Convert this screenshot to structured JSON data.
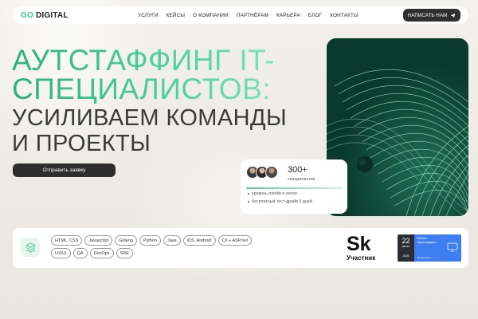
{
  "brand": {
    "part1": "GO",
    "part2": "DIGITAL",
    "accent": "#3bc68f"
  },
  "nav": {
    "items": [
      "УСЛУГИ",
      "КЕЙСЫ",
      "О КОМПАНИИ",
      "ПАРТНЁРАМ",
      "КАРЬЕРА",
      "БЛОГ",
      "КОНТАКТЫ"
    ],
    "cta_label": "НАПИСАТЬ НАМ",
    "cta_icon": "send-icon"
  },
  "hero": {
    "title_line1": "АУТСТАФФИНГ IT-",
    "title_line2": "СПЕЦИАЛИСТОВ:",
    "subtitle_line1": "УСИЛИВАЕМ КОМАНДЫ",
    "subtitle_line2": "И ПРОЕКТЫ",
    "apply_label": "Отправить заявку"
  },
  "stats": {
    "count": "300+",
    "count_label": "специалистов",
    "bullets": [
      "уровень middle и senior",
      "бесплатный тест-драйв 5 дней"
    ]
  },
  "technologies": {
    "row1": [
      "HTML, CSS",
      "Javascript",
      "Golang",
      "Python",
      "Java",
      "iOS, Android",
      "C# + ASP.net"
    ],
    "row2": [
      "UX/UI",
      "QA",
      "DevOps",
      "SRE"
    ]
  },
  "partners": {
    "skolkovo_mark": "Sk",
    "skolkovo_label": "Участник",
    "rating_day": "22",
    "rating_month": "место",
    "rating_year": "2025",
    "rating_title_line1": "Рейтинг",
    "rating_title_line2": "«Аутстаффинг»",
    "rating_url": "ratingruneta.ru"
  }
}
